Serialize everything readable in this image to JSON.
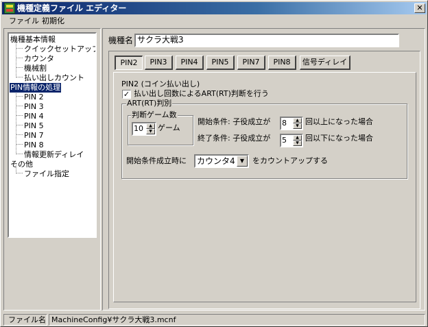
{
  "window": {
    "title": "機種定義ファイル エディター",
    "close_glyph": "✕"
  },
  "menu": {
    "items": [
      "ファイル",
      "初期化"
    ]
  },
  "tree": {
    "items": [
      {
        "label": "機種基本情報",
        "level": 0
      },
      {
        "label": "クイックセットアップ",
        "level": 1
      },
      {
        "label": "カウンタ",
        "level": 1
      },
      {
        "label": "機械割",
        "level": 1
      },
      {
        "label": "払い出しカウント",
        "level": 1
      },
      {
        "label": "PIN情報の処理",
        "level": 0,
        "selected": true
      },
      {
        "label": "PIN 2",
        "level": 1
      },
      {
        "label": "PIN 3",
        "level": 1
      },
      {
        "label": "PIN 4",
        "level": 1
      },
      {
        "label": "PIN 5",
        "level": 1
      },
      {
        "label": "PIN 7",
        "level": 1
      },
      {
        "label": "PIN 8",
        "level": 1
      },
      {
        "label": "情報更新ディレイ",
        "level": 1
      },
      {
        "label": "その他",
        "level": 0
      },
      {
        "label": "ファイル指定",
        "level": 1
      }
    ]
  },
  "model": {
    "label": "機種名",
    "value": "サクラ大戦3"
  },
  "tabs": [
    "PIN2",
    "PIN3",
    "PIN4",
    "PIN5",
    "PIN7",
    "PIN8",
    "信号ディレイ"
  ],
  "active_tab": "PIN2",
  "pin_panel": {
    "heading": "PIN2 (コイン払い出し)",
    "checkbox_label": "払い出し回数によるART(RT)判断を行う",
    "checkbox_checked": true,
    "checkbox_mark": "✓",
    "art_group_title": "ART(RT)判別",
    "games_group_title": "判断ゲーム数",
    "games_value": "10",
    "games_unit": "ゲーム",
    "start_condition_label": "開始条件: 子役成立が",
    "start_condition_value": "8",
    "start_condition_suffix": "回以上になった場合",
    "end_condition_label": "終了条件: 子役成立が",
    "end_condition_value": "5",
    "end_condition_suffix": "回以下になった場合",
    "counter_prefix": "開始条件成立時に",
    "counter_selected": "カウンタ4",
    "counter_suffix": "をカウントアップする"
  },
  "status": {
    "label": "ファイル名",
    "path": "MachineConfig¥サクラ大戦3.mcnf"
  }
}
